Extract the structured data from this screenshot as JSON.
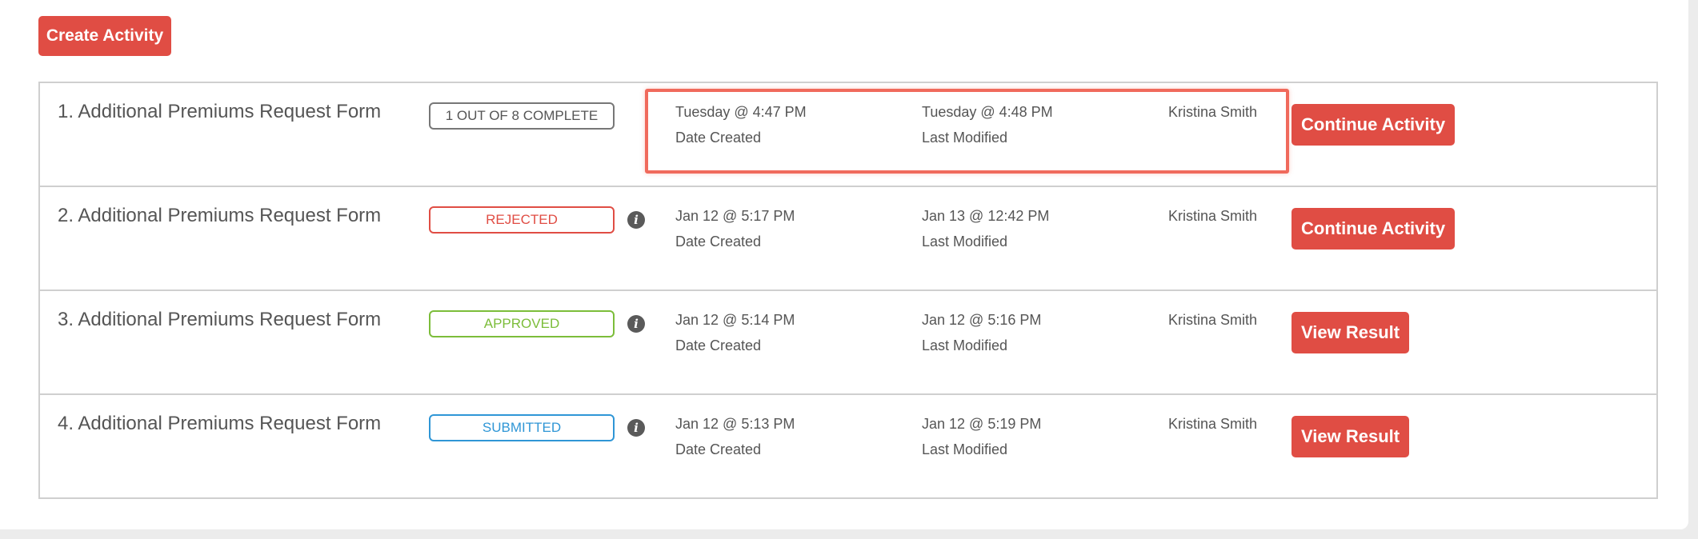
{
  "create_button": {
    "label": "Create Activity"
  },
  "rows": [
    {
      "title": "1. Additional Premiums Request Form",
      "status": "1 OUT OF 8 COMPLETE",
      "status_color": "#777777",
      "show_info": false,
      "date_created": "Tuesday @ 4:47 PM",
      "date_created_label": "Date Created",
      "last_modified": "Tuesday @ 4:48 PM",
      "last_modified_label": "Last Modified",
      "user": "Kristina Smith",
      "action": "Continue Activity"
    },
    {
      "title": "2. Additional Premiums Request Form",
      "status": "REJECTED",
      "status_color": "#e04d44",
      "show_info": true,
      "date_created": "Jan 12 @ 5:17 PM",
      "date_created_label": "Date Created",
      "last_modified": "Jan 13 @ 12:42 PM",
      "last_modified_label": "Last Modified",
      "user": "Kristina Smith",
      "action": "Continue Activity"
    },
    {
      "title": "3. Additional Premiums Request Form",
      "status": "APPROVED",
      "status_color": "#7cbd3a",
      "show_info": true,
      "date_created": "Jan 12 @ 5:14 PM",
      "date_created_label": "Date Created",
      "last_modified": "Jan 12 @ 5:16 PM",
      "last_modified_label": "Last Modified",
      "user": "Kristina Smith",
      "action": "View Result"
    },
    {
      "title": "4. Additional Premiums Request Form",
      "status": "SUBMITTED",
      "status_color": "#2f96d6",
      "show_info": true,
      "date_created": "Jan 12 @ 5:13 PM",
      "date_created_label": "Date Created",
      "last_modified": "Jan 12 @ 5:19 PM",
      "last_modified_label": "Last Modified",
      "user": "Kristina Smith",
      "action": "View Result"
    }
  ],
  "info_icon_glyph": "i",
  "colors": {
    "accent": "#e04d44",
    "highlight": "#f06a5c"
  }
}
